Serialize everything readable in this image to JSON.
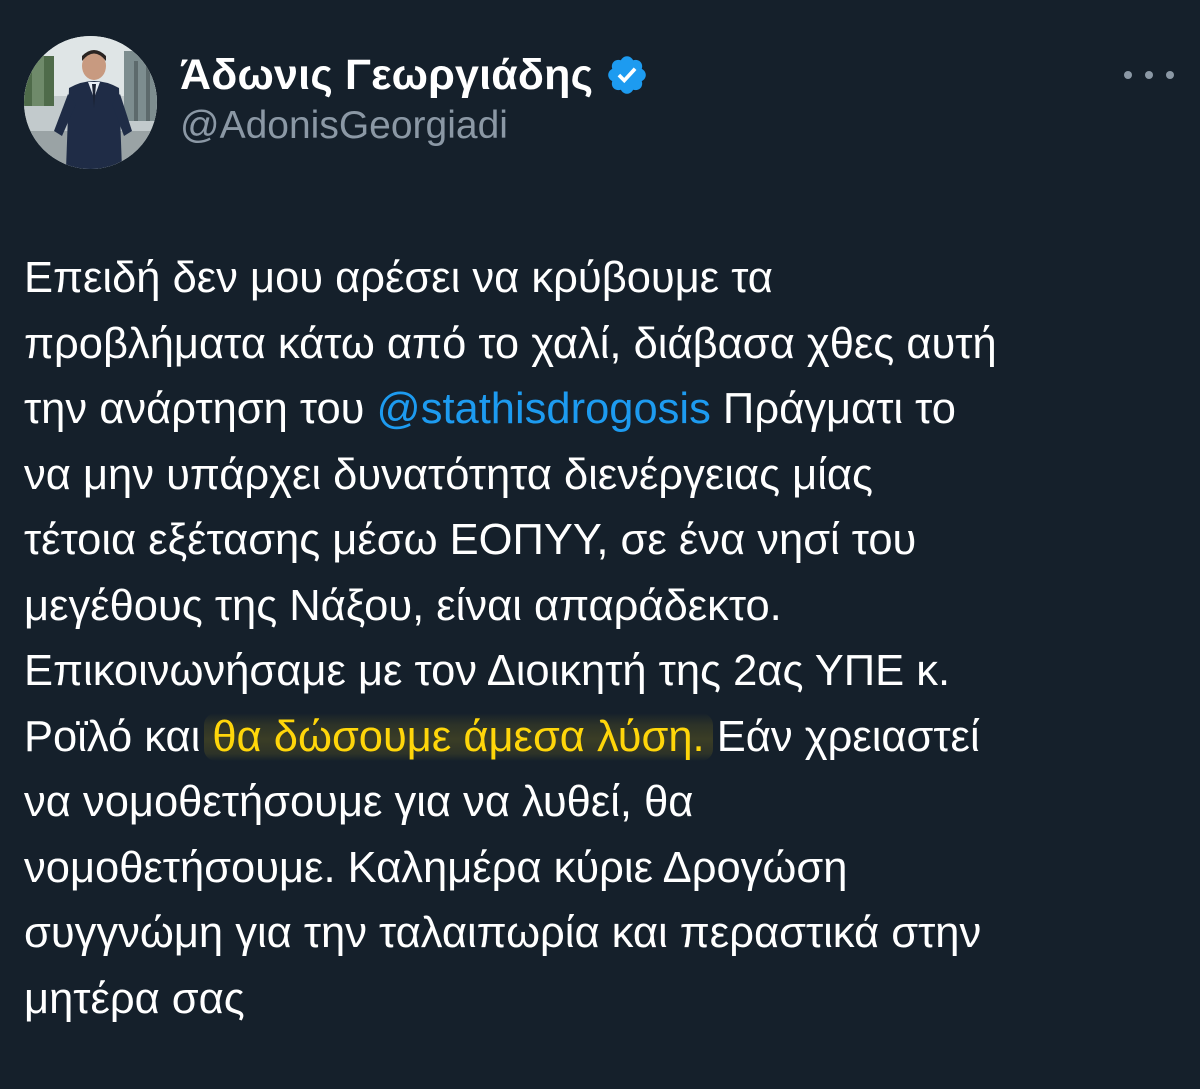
{
  "author": {
    "display_name": "Άδωνις Γεωργιάδης",
    "handle": "@AdonisGeorgiadi",
    "verified": true,
    "avatar_icon": "profile-photo"
  },
  "actions": {
    "more_icon": "more-horizontal-icon"
  },
  "tweet": {
    "lines": [
      {
        "parts": [
          {
            "text": "Επειδή δεν μου αρέσει να κρύβουμε τα"
          }
        ]
      },
      {
        "parts": [
          {
            "text": "προβλήματα κάτω από το χαλί, διάβασα χθες αυτή"
          }
        ]
      },
      {
        "parts": [
          {
            "text": "την ανάρτηση του "
          },
          {
            "text": "@stathisdrogosis",
            "type": "mention"
          },
          {
            "text": " Πράγματι το"
          }
        ]
      },
      {
        "parts": [
          {
            "text": "να μην υπάρχει δυνατότητα διενέργειας μίας"
          }
        ]
      },
      {
        "parts": [
          {
            "text": "τέτοια εξέτασης μέσω ΕΟΠΥΥ, σε ένα νησί του"
          }
        ]
      },
      {
        "parts": [
          {
            "text": "μεγέθους της Νάξου, είναι απαράδεκτο."
          }
        ]
      },
      {
        "parts": [
          {
            "text": "Επικοινωνήσαμε με τον Διοικητή της 2ας ΥΠΕ κ."
          }
        ]
      },
      {
        "parts": [
          {
            "text": "Ροϊλό και "
          },
          {
            "text": "θα δώσουμε άμεσα λύση.",
            "type": "highlight"
          },
          {
            "text": " Εάν χρειαστεί"
          }
        ]
      },
      {
        "parts": [
          {
            "text": "να νομοθετήσουμε για να λυθεί, θα"
          }
        ]
      },
      {
        "parts": [
          {
            "text": "νομοθετήσουμε. Καλημέρα κύριε Δρογώση"
          }
        ]
      },
      {
        "parts": [
          {
            "text": "συγγνώμη για την ταλαιπωρία και περαστικά στην"
          }
        ]
      },
      {
        "parts": [
          {
            "text": "μητέρα σας"
          }
        ]
      }
    ]
  },
  "colors": {
    "background": "#15202b",
    "text": "#ffffff",
    "secondary": "#8b98a5",
    "link": "#1d9bf0",
    "highlight": "#ffd60a",
    "verified_badge": "#1d9bf0"
  }
}
